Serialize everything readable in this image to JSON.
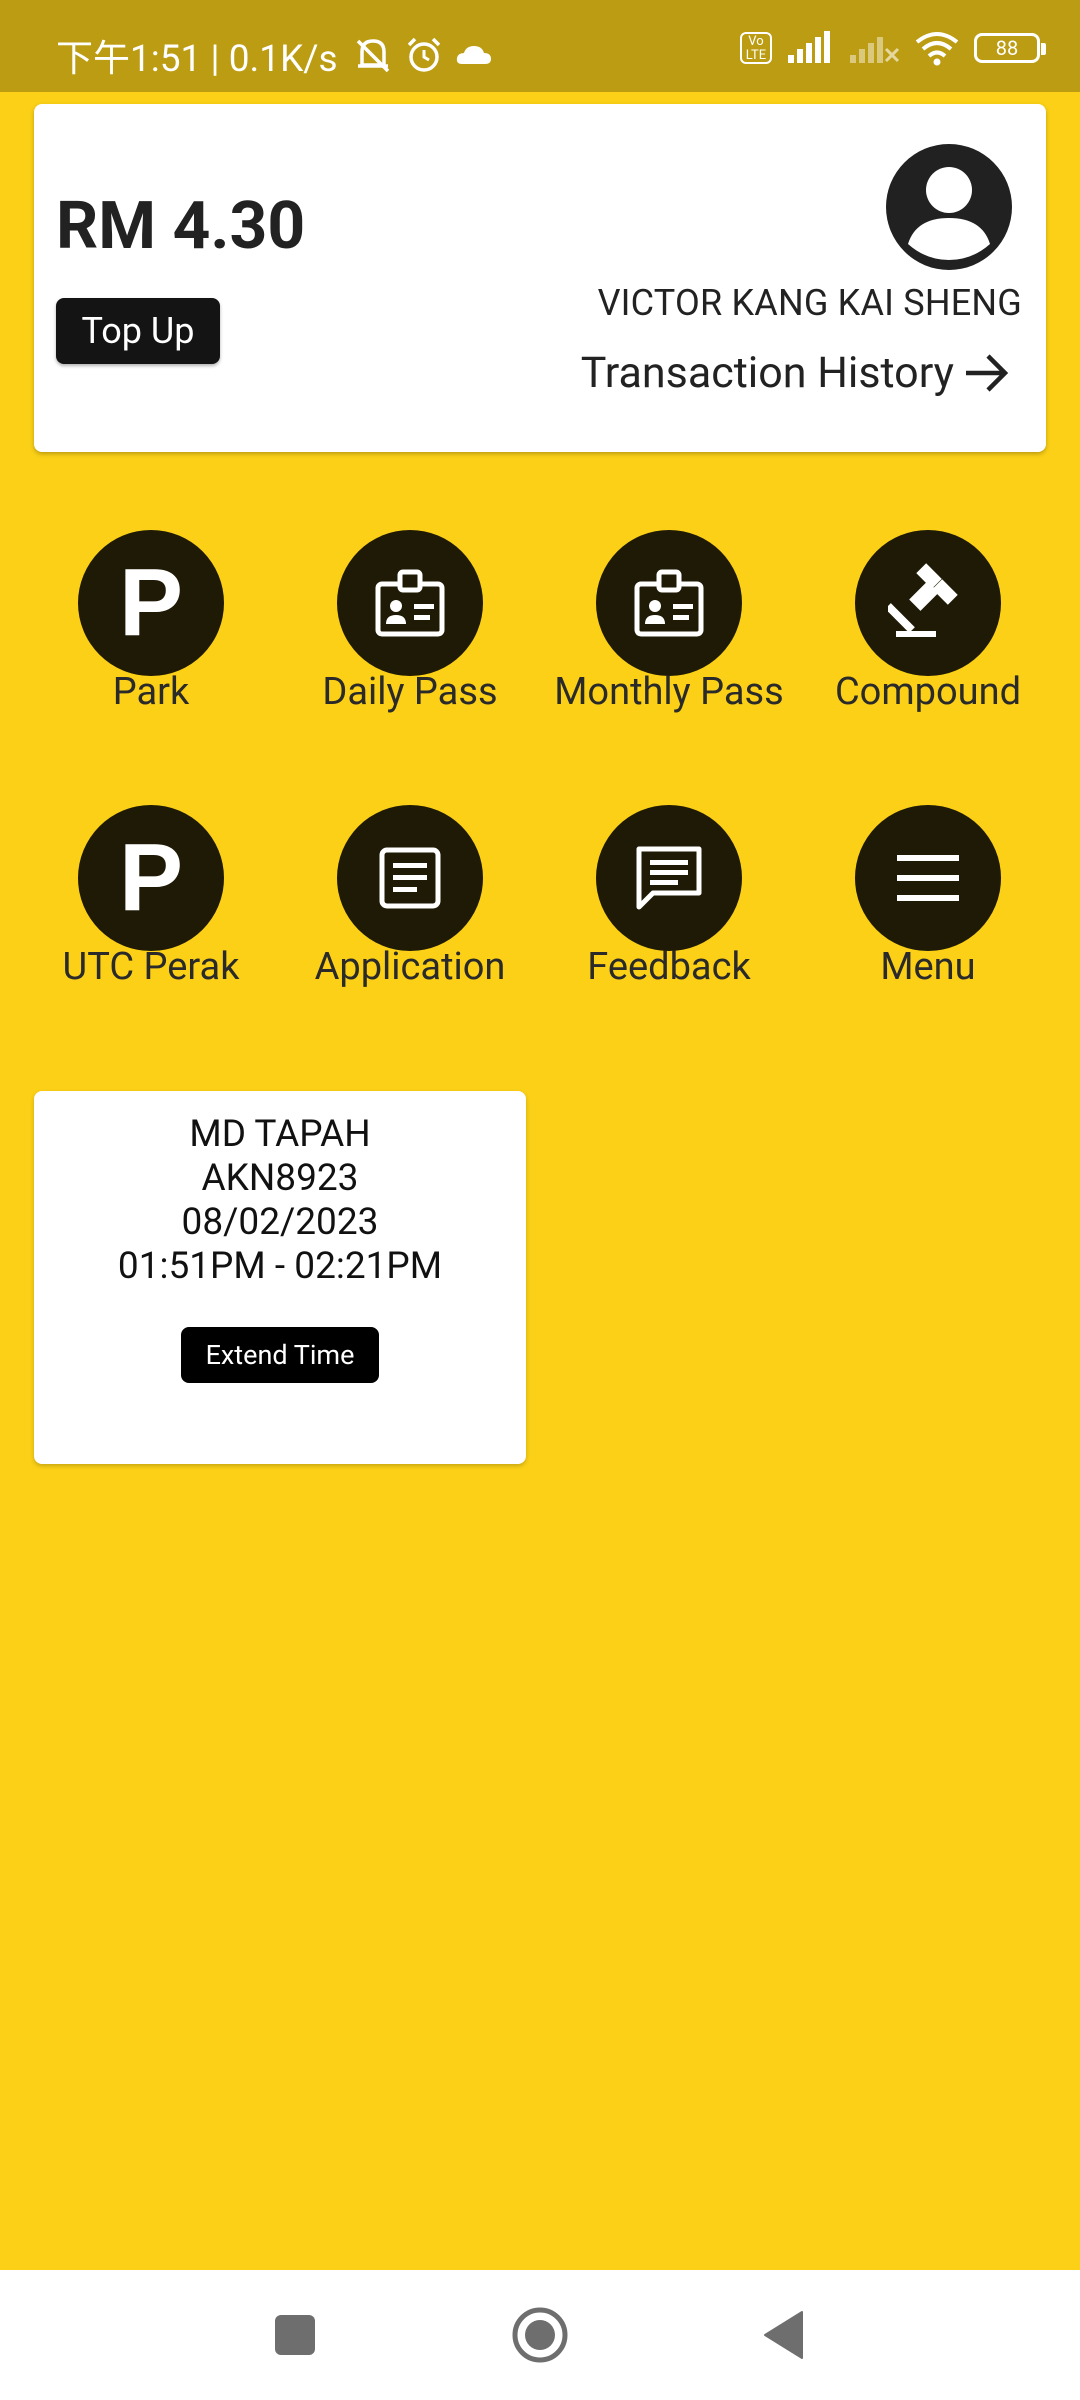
{
  "status_bar": {
    "time_text": "下午1:51 | 0.1K/s",
    "battery": "88"
  },
  "wallet": {
    "balance": "RM 4.30",
    "topup_label": "Top Up",
    "user_name": "VICTOR KANG KAI SHENG",
    "history_label": "Transaction History"
  },
  "menu": [
    {
      "label": "Park",
      "icon": "parking-p-icon"
    },
    {
      "label": "Daily Pass",
      "icon": "id-badge-icon"
    },
    {
      "label": "Monthly Pass",
      "icon": "id-badge-icon"
    },
    {
      "label": "Compound",
      "icon": "gavel-icon"
    },
    {
      "label": "UTC Perak",
      "icon": "parking-p-icon"
    },
    {
      "label": "Application",
      "icon": "document-icon"
    },
    {
      "label": "Feedback",
      "icon": "chat-icon"
    },
    {
      "label": "Menu",
      "icon": "hamburger-icon"
    }
  ],
  "session": {
    "location": "MD TAPAH",
    "plate": "AKN8923",
    "date": "08/02/2023",
    "time_range": "01:51PM - 02:21PM",
    "extend_label": "Extend Time"
  },
  "colors": {
    "background": "#FBD016",
    "status_bar": "#BC9C12",
    "icon_circle": "#1F1A06"
  }
}
